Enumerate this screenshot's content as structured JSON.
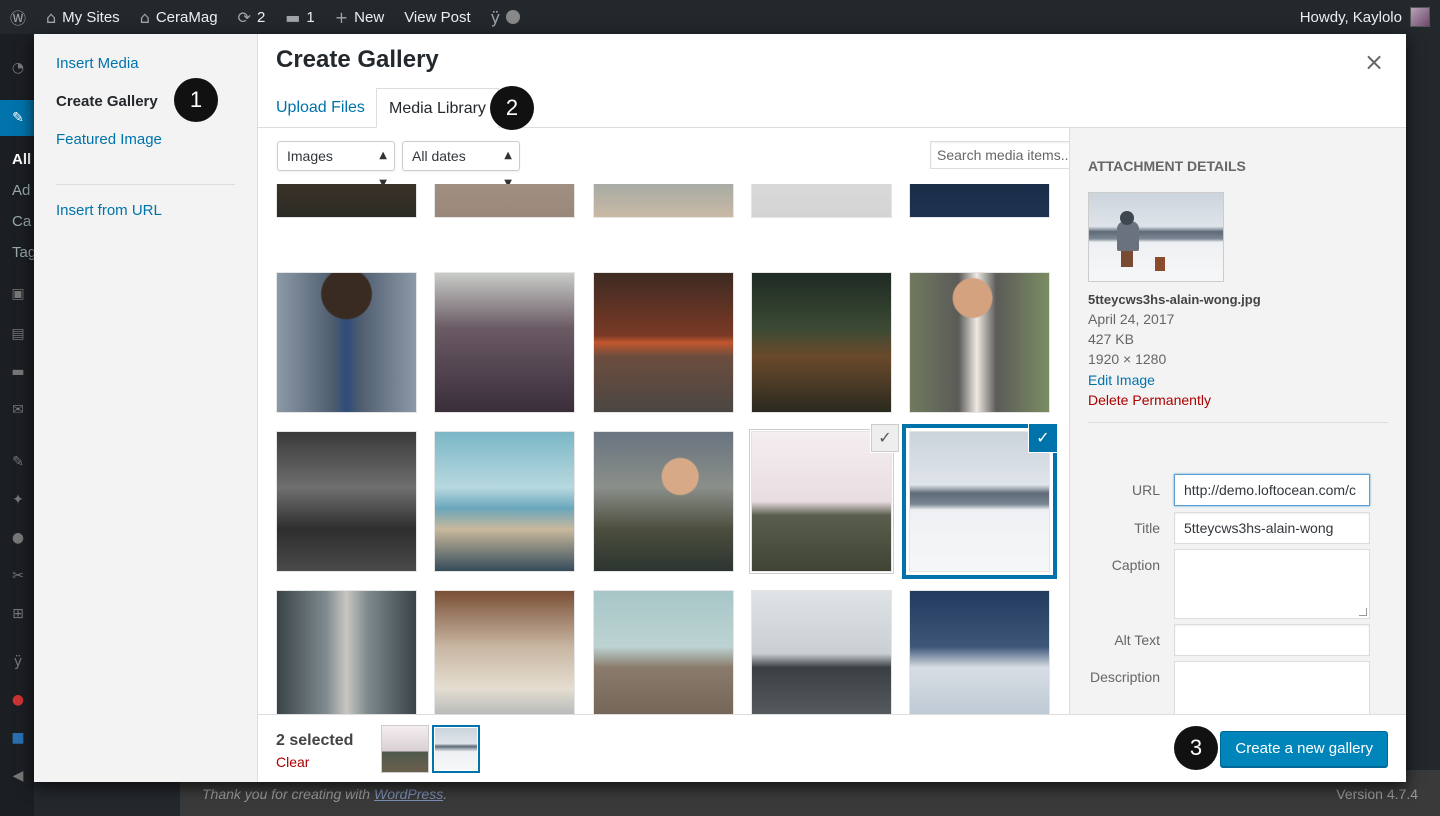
{
  "adminbar": {
    "my_sites": "My Sites",
    "site_name": "CeraMag",
    "updates_count": "2",
    "comments_count": "1",
    "new_label": "New",
    "view_post": "View Post",
    "howdy": "Howdy, Kaylolo",
    "icons": [
      "wordpress-icon",
      "my-sites-icon",
      "home-icon",
      "updates-icon",
      "comments-icon",
      "plus-icon",
      "yoast-icon"
    ]
  },
  "adminmenu_fragments": [
    "All",
    "Ad",
    "Ca",
    "Tag"
  ],
  "footer": {
    "thanks_prefix": "Thank you for creating with ",
    "thanks_link": "WordPress",
    "thanks_suffix": ".",
    "version": "Version 4.7.4"
  },
  "modal": {
    "title": "Create Gallery",
    "close_glyph": "×",
    "menu": {
      "insert_media": "Insert Media",
      "create_gallery": "Create Gallery",
      "featured_image": "Featured Image",
      "insert_from_url": "Insert from URL"
    },
    "tabs": {
      "upload": "Upload Files",
      "library": "Media Library"
    },
    "toolbar": {
      "type_filter": "Images",
      "date_filter": "All dates",
      "search_placeholder": "Search media items..."
    },
    "details": {
      "heading": "Attachment Details",
      "filename": "5tteycws3hs-alain-wong.jpg",
      "date": "April 24, 2017",
      "size": "427 KB",
      "dimensions": "1920 × 1280",
      "edit_image": "Edit Image",
      "delete": "Delete Permanently",
      "fields": {
        "url_label": "URL",
        "url_value": "http://demo.loftocean.com/c",
        "title_label": "Title",
        "title_value": "5tteycws3hs-alain-wong",
        "caption_label": "Caption",
        "alt_label": "Alt Text",
        "description_label": "Description"
      }
    },
    "bottom": {
      "selected_count": "2 selected",
      "clear": "Clear",
      "create_button": "Create a new gallery"
    }
  },
  "badges": [
    "1",
    "2",
    "3"
  ],
  "check_glyph": "✓",
  "colors": {
    "link": "#0073aa",
    "primary": "#0085ba",
    "danger": "#a00",
    "admin_bar": "#23282d"
  }
}
